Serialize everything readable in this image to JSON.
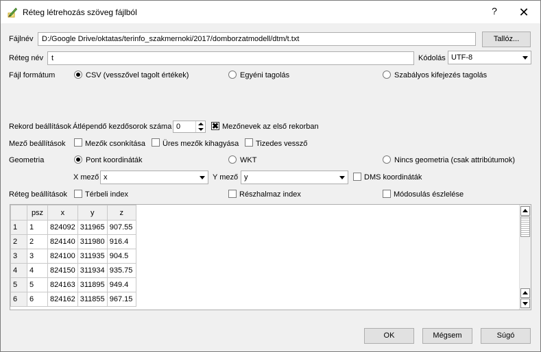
{
  "window": {
    "title": "Réteg létrehozás szöveg fájlból",
    "help_label": "?",
    "close_label": "✕"
  },
  "file": {
    "label": "Fájlnév",
    "value": "D:/Google Drive/oktatas/terinfo_szakmernoki/2017/domborzatmodell/dtm/t.txt",
    "browse_label": "Tallóz..."
  },
  "layer": {
    "label": "Réteg név",
    "value": "t",
    "encoding_label": "Kódolás",
    "encoding_value": "UTF-8"
  },
  "format": {
    "label": "Fájl formátum",
    "options": [
      {
        "label": "CSV (vesszővel tagolt értékek)",
        "checked": true
      },
      {
        "label": "Egyéni tagolás",
        "checked": false
      },
      {
        "label": "Szabályos kifejezés tagolás",
        "checked": false
      }
    ]
  },
  "records": {
    "label": "Rekord beállítások",
    "skip_label": "Átlépendő kezdősorok száma",
    "skip_value": "0",
    "header_checkbox": {
      "label": "Mezőnevek az első rekorban",
      "checked": true
    }
  },
  "fields": {
    "label": "Mező beállítások",
    "options": [
      {
        "label": "Mezők csonkítása",
        "checked": false
      },
      {
        "label": "Üres mezők kihagyása",
        "checked": false
      },
      {
        "label": "Tizedes vessző",
        "checked": false
      }
    ]
  },
  "geometry": {
    "label": "Geometria",
    "options": [
      {
        "label": "Pont koordináták",
        "checked": true
      },
      {
        "label": "WKT",
        "checked": false
      },
      {
        "label": "Nincs geometria (csak attribútumok)",
        "checked": false
      }
    ],
    "x_label": "X mező",
    "x_value": "x",
    "y_label": "Y mező",
    "y_value": "y",
    "dms_label": "DMS koordináták",
    "dms_checked": false
  },
  "layer_settings": {
    "label": "Réteg beállítások",
    "options": [
      {
        "label": "Térbeli index",
        "checked": false
      },
      {
        "label": "Részhalmaz index",
        "checked": false
      },
      {
        "label": "Módosulás észlelése",
        "checked": false
      }
    ]
  },
  "table": {
    "columns": [
      "psz",
      "x",
      "y",
      "z"
    ],
    "rows": [
      {
        "n": "1",
        "cells": [
          "1",
          "824092",
          "311965",
          "907.55"
        ]
      },
      {
        "n": "2",
        "cells": [
          "2",
          "824140",
          "311980",
          "916.4"
        ]
      },
      {
        "n": "3",
        "cells": [
          "3",
          "824100",
          "311935",
          "904.5"
        ]
      },
      {
        "n": "4",
        "cells": [
          "4",
          "824150",
          "311934",
          "935.75"
        ]
      },
      {
        "n": "5",
        "cells": [
          "5",
          "824163",
          "311895",
          "949.4"
        ]
      },
      {
        "n": "6",
        "cells": [
          "6",
          "824162",
          "311855",
          "967.15"
        ]
      }
    ]
  },
  "buttons": {
    "ok": "OK",
    "cancel": "Mégsem",
    "help": "Súgó"
  },
  "colors": {
    "dialog_bg": "#f0f0f0",
    "title_bg": "#ffffff"
  }
}
